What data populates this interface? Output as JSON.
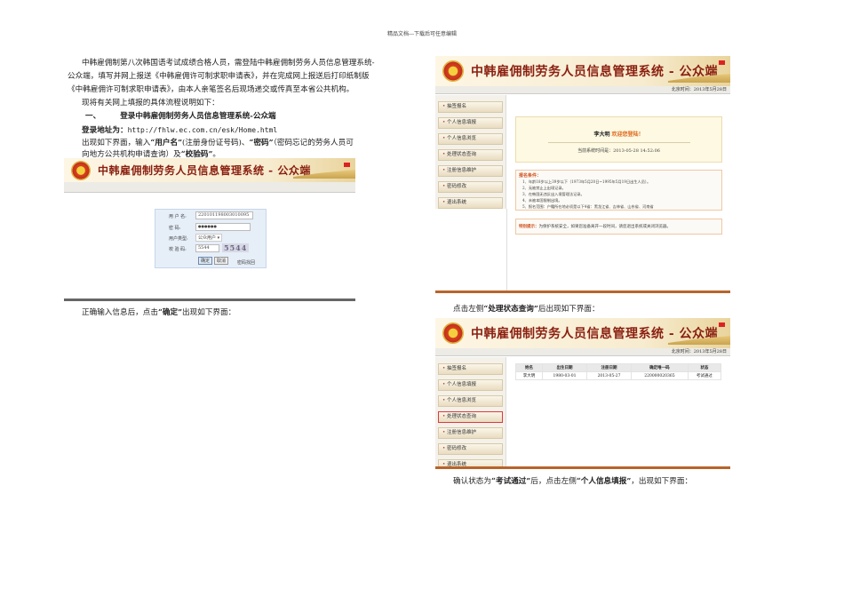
{
  "page_header": "精品文档---下载后可任意编辑",
  "intro": [
    "中韩雇佣制第八次韩国语考试成绩合格人员，需登陆中韩雇佣制劳务人员信息管理系统-",
    "公众端，填写并网上报送《中韩雇佣许可制求职申请表》，并在完成网上报送后打印纸制版",
    "《中韩雇佣许可制求职申请表》，由本人亲笔签名后现场递交或传真至本省公共机构。"
  ],
  "flow_intro": "现将有关网上填报的具体流程说明如下：",
  "section1": {
    "num": "一、",
    "title": "登录中韩雇佣制劳务人员信息管理系统-公众端"
  },
  "login_addr_label": "登录地址为：",
  "login_addr": "http://fhlw.ec.com.cn/esk/Home.html",
  "instr": {
    "a": "出现如下界面，输入",
    "b": "“用户名”",
    "c": "(注册身份证号码)、",
    "d": "“密码”",
    "e": "（密码忘记的劳务人员可",
    "f": "向地方公共机构申请查询）及",
    "g": "“校验码”",
    "h": "。"
  },
  "system_title": "中韩雇佣制劳务人员信息管理系统 - 公众端",
  "login": {
    "user_label": "用 户 名:",
    "user_value": "220101198003010095",
    "pwd_label": "密    码:",
    "pwd_value": "●●●●●●",
    "type_label": "用户类型:",
    "type_value": "公众用户 ▾",
    "code_label": "校 验 码:",
    "code_value": "5544",
    "captcha": "5544",
    "ok": "确定",
    "cancel": "取消",
    "forgot": "密码找回"
  },
  "after_login": {
    "a": "正确输入信息后，点击",
    "b": "“确定”",
    "c": "出现如下界面："
  },
  "time_label": "北京时间：2013年5月28日",
  "menu": [
    "抽签报名",
    "个人信息填报",
    "个人信息浏览",
    "处理状态查询",
    "注册信息维护",
    "密码修改",
    "退出系统"
  ],
  "welcome": {
    "name": "李大明",
    "greet": "欢迎您登陆！",
    "last_login": "当前系统时间是：2013-05-28 14:52:06"
  },
  "conditions": {
    "title": "报名条件：",
    "items": [
      "1、年龄18岁以上39岁以下（1973年5月20日~1995年5月19日出生人员）。",
      "2、无被禁止上出境记录。",
      "3、在韩国无违反出入境管理法记录。",
      "4、未被本国限制出境。",
      "5、报名范围：户籍所在地必须是以下4省：黑龙江省、吉林省、山东省、河南省"
    ]
  },
  "notice": {
    "label": "特别提示：",
    "text": "为保护系统安全，如果您准备离开一段时间，请您退出系统或关闭浏览器。"
  },
  "click_status": {
    "a": "点击左侧",
    "b": "“处理状态查询”",
    "c": "后出现如下界面："
  },
  "status_table": {
    "headers": [
      "姓名",
      "出生日期",
      "注册日期",
      "确定唯一码",
      "状态"
    ],
    "rows": [
      [
        "李大明",
        "1980-03-01",
        "2013-05-27",
        "220000020365",
        "考试通过"
      ]
    ]
  },
  "confirm": {
    "a": "确认状态为",
    "b": "“考试通过”",
    "c": "后，点击左侧",
    "d": "“个人信息填报”",
    "e": "，出现如下界面："
  }
}
